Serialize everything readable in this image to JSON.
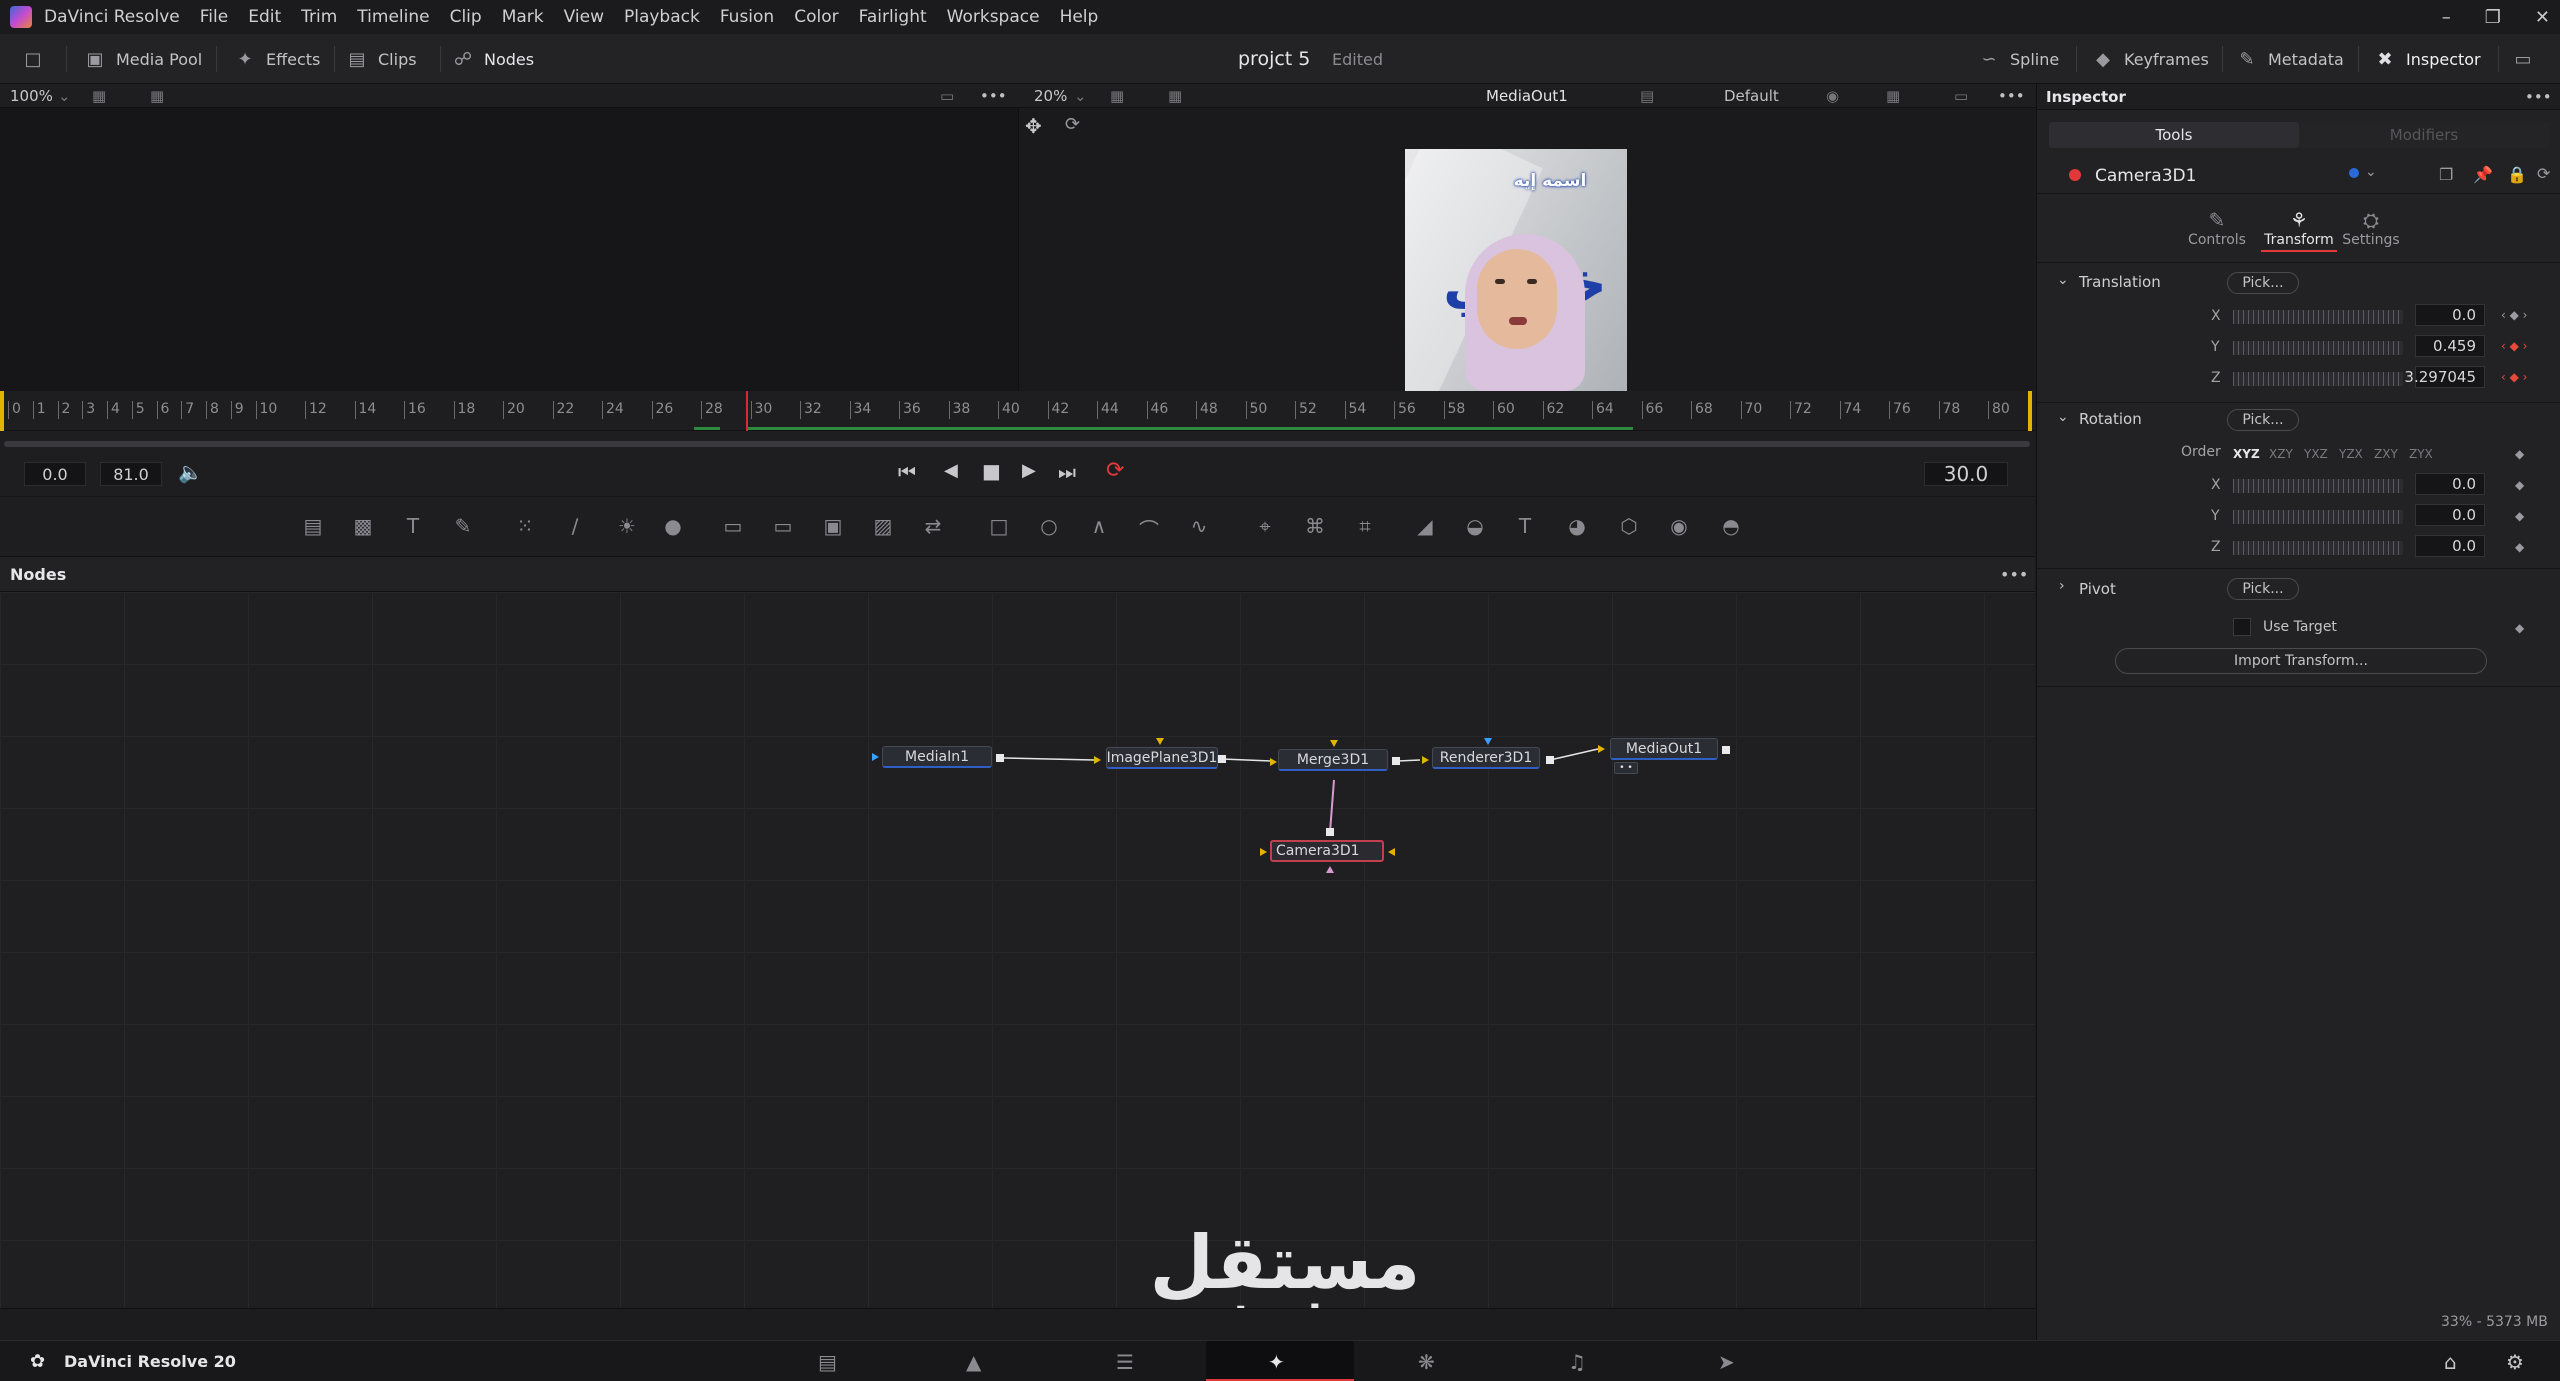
{
  "app": {
    "name": "DaVinci Resolve",
    "brand_version": "DaVinci Resolve 20"
  },
  "menu": [
    "File",
    "Edit",
    "Trim",
    "Timeline",
    "Clip",
    "Mark",
    "View",
    "Playback",
    "Fusion",
    "Color",
    "Fairlight",
    "Workspace",
    "Help"
  ],
  "toolbar": {
    "media_pool": "Media Pool",
    "effects": "Effects",
    "clips": "Clips",
    "nodes": "Nodes",
    "project_title": "projct 5",
    "project_status": "Edited",
    "spline": "Spline",
    "keyframes": "Keyframes",
    "metadata": "Metadata",
    "inspector": "Inspector"
  },
  "viewer_left": {
    "zoom": "100%"
  },
  "viewer_right": {
    "zoom": "20%",
    "output_name": "MediaOut1",
    "lut": "Default"
  },
  "video_overlay": {
    "caption": "اسمه إيه",
    "big_text": "ختباي"
  },
  "ruler": {
    "ticks": [
      "0",
      "1",
      "2",
      "3",
      "4",
      "5",
      "6",
      "7",
      "8",
      "9",
      "10",
      "12",
      "14",
      "16",
      "18",
      "20",
      "22",
      "24",
      "26",
      "28",
      "30",
      "32",
      "34",
      "36",
      "38",
      "40",
      "42",
      "44",
      "46",
      "48",
      "50",
      "52",
      "54",
      "56",
      "58",
      "60",
      "62",
      "64",
      "66",
      "68",
      "70",
      "72",
      "74",
      "76",
      "78",
      "80"
    ]
  },
  "transport": {
    "start": "0.0",
    "end": "81.0",
    "current_frame": "30.0"
  },
  "nodes_panel": {
    "title": "Nodes"
  },
  "nodes": {
    "mediain": "MediaIn1",
    "imageplane": "ImagePlane3D1",
    "merge": "Merge3D1",
    "renderer": "Renderer3D1",
    "mediaout": "MediaOut1",
    "camera": "Camera3D1"
  },
  "status": {
    "memory": "33% - 5373 MB"
  },
  "watermark": {
    "arabic": "مستقل",
    "latin": "mostaql.com"
  },
  "inspector": {
    "title": "Inspector",
    "tabs": {
      "tools": "Tools",
      "modifiers": "Modifiers"
    },
    "node_name": "Camera3D1",
    "subtabs": {
      "controls": "Controls",
      "transform": "Transform",
      "settings": "Settings"
    },
    "translation": {
      "label": "Translation",
      "pick": "Pick...",
      "x_label": "X",
      "y_label": "Y",
      "z_label": "Z",
      "x": "0.0",
      "y": "0.459",
      "z": "3.297045"
    },
    "rotation": {
      "label": "Rotation",
      "pick": "Pick...",
      "order_label": "Order",
      "orders": [
        "XYZ",
        "XZY",
        "YXZ",
        "YZX",
        "ZXY",
        "ZYX"
      ],
      "x_label": "X",
      "y_label": "Y",
      "z_label": "Z",
      "x": "0.0",
      "y": "0.0",
      "z": "0.0"
    },
    "pivot": {
      "label": "Pivot",
      "pick": "Pick..."
    },
    "use_target": "Use Target",
    "import_transform": "Import Transform..."
  }
}
